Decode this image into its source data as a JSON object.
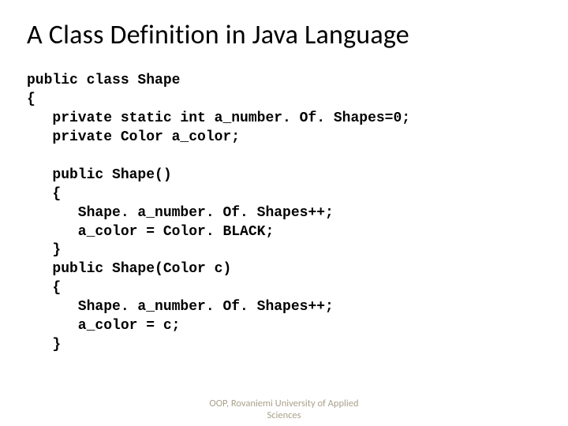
{
  "title": "A Class Definition in Java Language",
  "code": {
    "l1": "public class Shape",
    "l2": "{",
    "l3": "   private static int a_number. Of. Shapes=0;",
    "l4": "   private Color a_color;",
    "l5": "",
    "l6": "   public Shape()",
    "l7": "   {",
    "l8": "      Shape. a_number. Of. Shapes++;",
    "l9": "      a_color = Color. BLACK;",
    "l10": "   }",
    "l11": "   public Shape(Color c)",
    "l12": "   {",
    "l13": "      Shape. a_number. Of. Shapes++;",
    "l14": "      a_color = c;",
    "l15": "   }"
  },
  "footer": {
    "line1": "OOP, Rovaniemi University of Applied",
    "line2": "Sciences"
  }
}
